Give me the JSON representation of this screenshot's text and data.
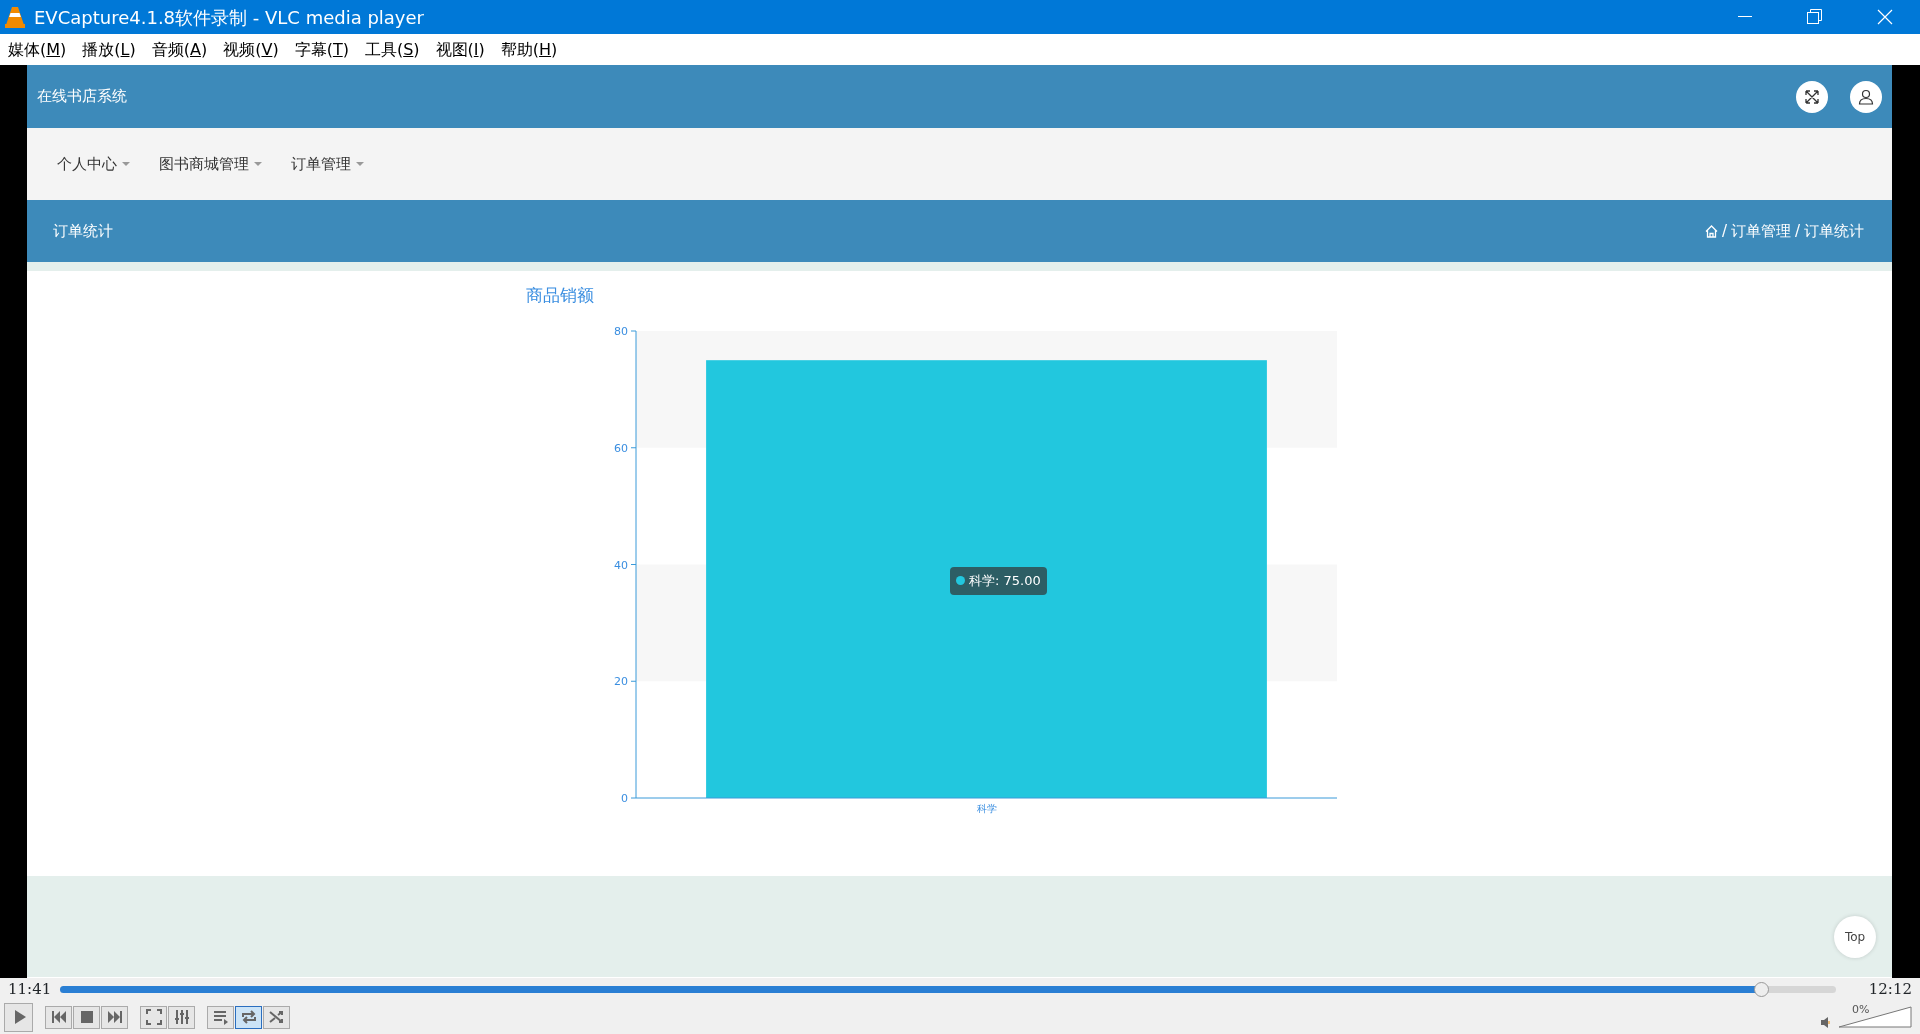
{
  "window": {
    "title": "EVCapture4.1.8软件录制 - VLC media player"
  },
  "menu": [
    {
      "label": "媒体(M)"
    },
    {
      "label": "播放(L)"
    },
    {
      "label": "音频(A)"
    },
    {
      "label": "视频(V)"
    },
    {
      "label": "字幕(T)"
    },
    {
      "label": "工具(S)"
    },
    {
      "label": "视图(I)"
    },
    {
      "label": "帮助(H)"
    }
  ],
  "video": {
    "site_title": "在线书店系统",
    "nav": [
      {
        "label": "个人中心"
      },
      {
        "label": "图书商城管理"
      },
      {
        "label": "订单管理"
      }
    ],
    "page_title": "订单统计",
    "breadcrumb_separator": "/",
    "breadcrumb": [
      "订单管理",
      "订单统计"
    ],
    "chart_data": {
      "type": "bar",
      "title": "商品销额",
      "categories": [
        "科学"
      ],
      "series": [
        {
          "color": "#22c7de",
          "values": [
            75
          ]
        }
      ],
      "ylim": [
        0,
        80
      ],
      "yticks": [
        0,
        20,
        40,
        60,
        80
      ]
    },
    "tooltip": {
      "label": "科学: 75.00"
    },
    "top_button": "Top"
  },
  "player": {
    "elapsed": "11:41",
    "total": "12:12",
    "level": 0.958,
    "controls": [
      {
        "kind": "play",
        "on": false
      },
      {
        "kind": "prev",
        "on": false
      },
      {
        "kind": "stop",
        "on": false
      },
      {
        "kind": "next",
        "on": false
      },
      {
        "kind": "fullscreen",
        "on": false
      },
      {
        "kind": "extended",
        "on": false
      },
      {
        "kind": "playlist",
        "on": false
      },
      {
        "kind": "loop",
        "on": true
      },
      {
        "kind": "random",
        "on": false
      }
    ],
    "volume": {
      "reading": "0%",
      "level": 0
    }
  }
}
